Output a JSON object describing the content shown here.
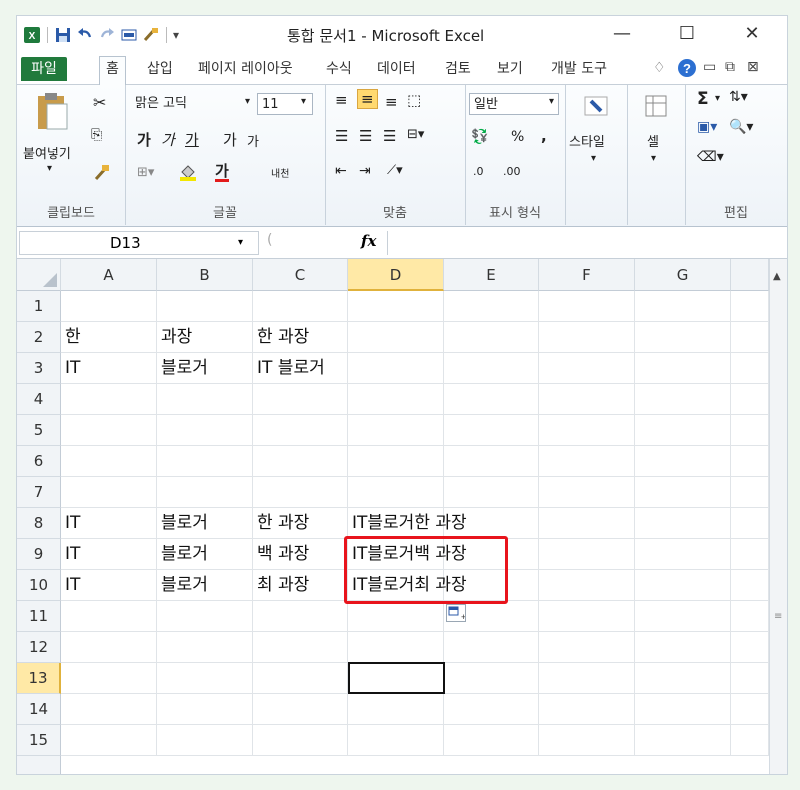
{
  "window": {
    "title": "통합 문서1 - Microsoft Excel",
    "minimize": "—",
    "maximize": "☐",
    "close": "✕"
  },
  "ribbon_tabs": [
    "파일",
    "홈",
    "삽입",
    "페이지 레이아웃",
    "수식",
    "데이터",
    "검토",
    "보기",
    "개발 도구"
  ],
  "ribbon": {
    "clipboard": {
      "paste": "붙여넣기",
      "group": "클립보드"
    },
    "font": {
      "name": "맑은 고딕",
      "size": "11",
      "group": "글꼴",
      "bold": "가",
      "italic": "가",
      "underline": "가",
      "grow": "가",
      "shrink": "가",
      "color_a": "가",
      "phonetic": "내천"
    },
    "alignment": {
      "group": "맞춤"
    },
    "number": {
      "format": "일반",
      "percent": "%",
      "comma": ",",
      "inc": ".0",
      "dec": ".00",
      "group": "표시 형식"
    },
    "styles": {
      "label": "스타일"
    },
    "cells": {
      "label": "셀"
    },
    "editing": {
      "group": "편집",
      "sum": "Σ"
    }
  },
  "formula_bar": {
    "name_box": "D13",
    "fx": "fx",
    "value": ""
  },
  "columns": [
    "A",
    "B",
    "C",
    "D",
    "E",
    "F",
    "G"
  ],
  "rows": [
    "1",
    "2",
    "3",
    "4",
    "5",
    "6",
    "7",
    "8",
    "9",
    "10",
    "11",
    "12",
    "13",
    "14",
    "15"
  ],
  "cells": {
    "A2": "한",
    "B2": "과장",
    "C2": "한 과장",
    "A3": "IT",
    "B3": "블로거",
    "C3": "IT 블로거",
    "A8": "IT",
    "B8": "블로거",
    "C8": "한 과장",
    "D8": "IT블로거한 과장",
    "A9": "IT",
    "B9": "블로거",
    "C9": "백 과장",
    "D9": "IT블로거백 과장",
    "A10": "IT",
    "B10": "블로거",
    "C10": "최 과장",
    "D10": "IT블로거최 과장"
  },
  "active_cell": "D13",
  "colors": {
    "file_tab": "#217a3c",
    "highlight": "#e8141c",
    "header_selected": "#ffe9a6"
  }
}
